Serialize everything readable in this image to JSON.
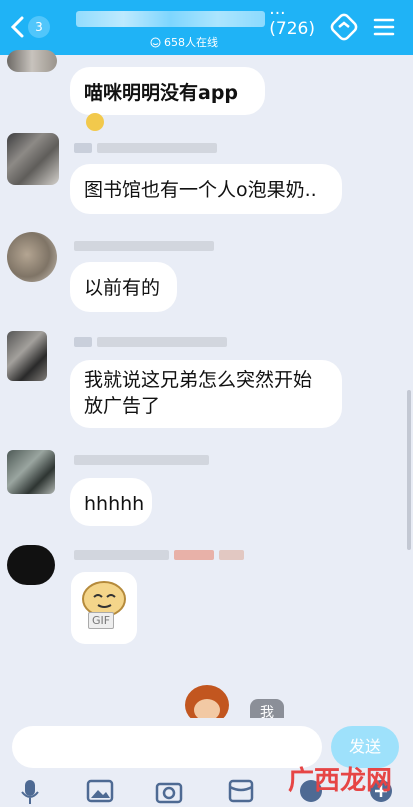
{
  "header": {
    "badge": "3",
    "title_suffix": "...(726)",
    "online": "658人在线"
  },
  "messages": [
    {
      "text": "喵咪明明没有app"
    },
    {
      "text": "图书馆也有一个人o泡果奶.."
    },
    {
      "text": "以前有的"
    },
    {
      "text_line1": "我就说这兄弟怎么突然开始",
      "text_line2": "放广告了"
    },
    {
      "text": "hhhhh"
    },
    {
      "gif_label": "GIF"
    }
  ],
  "preview_bubble": "我",
  "composer": {
    "placeholder": "",
    "send_label": "发送"
  },
  "toolbar": [
    "mic-icon",
    "image-icon",
    "camera-icon",
    "red-packet-icon",
    "emoji-icon",
    "plus-icon"
  ],
  "watermark": "广西龙网"
}
